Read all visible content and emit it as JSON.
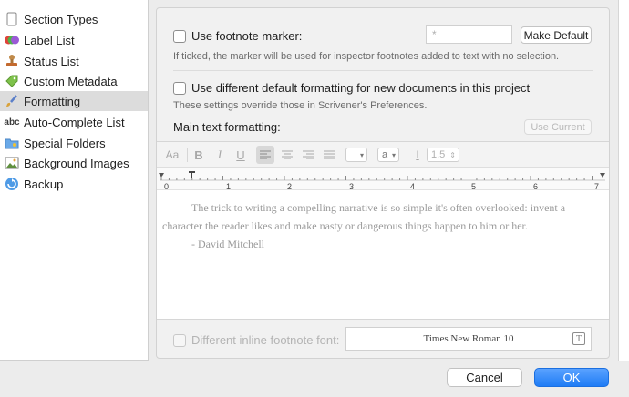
{
  "sidebar": {
    "items": [
      {
        "label": "Section Types",
        "icon": "document-icon"
      },
      {
        "label": "Label List",
        "icon": "color-circles-icon"
      },
      {
        "label": "Status List",
        "icon": "stamp-icon"
      },
      {
        "label": "Custom Metadata",
        "icon": "tag-icon"
      },
      {
        "label": "Formatting",
        "icon": "paintbrush-icon",
        "selected": true
      },
      {
        "label": "Auto-Complete List",
        "icon": "abc-icon"
      },
      {
        "label": "Special Folders",
        "icon": "folder-icon"
      },
      {
        "label": "Background Images",
        "icon": "picture-icon"
      },
      {
        "label": "Backup",
        "icon": "backup-icon"
      }
    ]
  },
  "formatting": {
    "footnote_marker": {
      "label": "Use footnote marker:",
      "value": "*",
      "make_default": "Make Default",
      "note": "If ticked, the marker will be used for inspector footnotes added to text with no selection."
    },
    "different_default": {
      "label": "Use different default formatting for new documents in this project",
      "note": "These settings override those in Scrivener's Preferences."
    },
    "main_text_label": "Main text formatting:",
    "use_current": "Use Current",
    "toolbar": {
      "font_glyph": "Aa",
      "bold": "B",
      "italic": "I",
      "underline": "U",
      "highlight_select": "a",
      "line_spacing": "1.5"
    },
    "ruler": {
      "numbers": [
        "0",
        "1",
        "2",
        "3",
        "4",
        "5",
        "6",
        "7"
      ]
    },
    "sample_text": {
      "line1": "The trick to writing a compelling narrative is so simple it's often overlooked: invent a character the reader likes and make nasty or dangerous things happen to him or her.",
      "attribution": "- David Mitchell"
    },
    "inline_footnote": {
      "label": "Different inline footnote font:",
      "font": "Times New Roman 10"
    }
  },
  "footer": {
    "cancel": "Cancel",
    "ok": "OK"
  }
}
